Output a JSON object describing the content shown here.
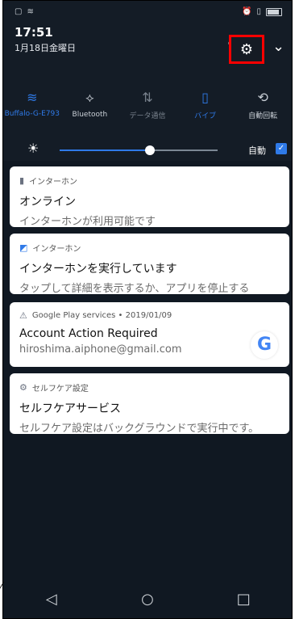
{
  "status": {
    "left_icons": [
      "sim-icon",
      "wifi-icon"
    ],
    "right_icons": [
      "alarm-icon",
      "vibrate-icon",
      "battery-icon"
    ]
  },
  "header": {
    "time": "17:51",
    "date": "1月18日金曜日"
  },
  "quick_tiles": [
    {
      "label": "Buffalo-G-E793",
      "icon": "wifi-icon",
      "state": "on"
    },
    {
      "label": "Bluetooth",
      "icon": "bluetooth-icon",
      "state": "off"
    },
    {
      "label": "データ通信",
      "icon": "mobile-data-icon",
      "state": "dim"
    },
    {
      "label": "バイブ",
      "icon": "vibrate-icon",
      "state": "on"
    },
    {
      "label": "自動回転",
      "icon": "rotate-icon",
      "state": "off"
    }
  ],
  "brightness": {
    "auto_label": "自動",
    "level": 0.57
  },
  "notifications": [
    {
      "app": "インターホン",
      "title": "オンライン",
      "text": "インターホンが利用可能です"
    },
    {
      "app": "インターホン",
      "title": "インターホンを実行しています",
      "text": "タップして詳細を表示するか、アプリを停止する"
    },
    {
      "app": "Google Play services • 2019/01/09",
      "title": "Account Action Required",
      "text": "hiroshima.aiphone@gmail.com",
      "badge": "G"
    },
    {
      "app": "セルフケア設定",
      "title": "セルフケアサービス",
      "text": "セルフケア設定はバックグラウンドで実行中です。"
    }
  ]
}
